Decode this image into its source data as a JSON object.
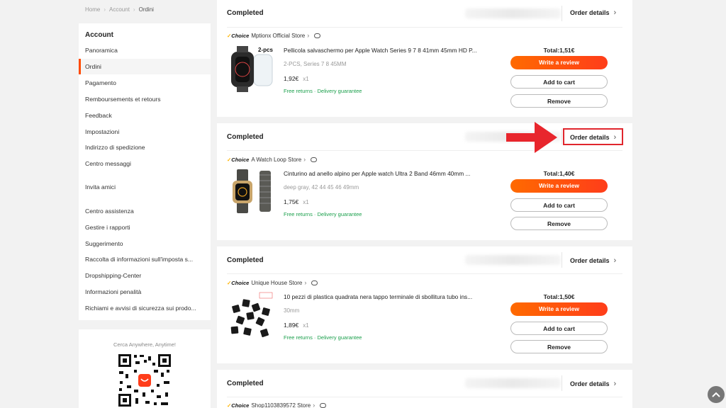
{
  "breadcrumb": [
    "Home",
    "Account",
    "Ordini"
  ],
  "sidebar": {
    "title": "Account",
    "items": [
      "Panoramica",
      "Ordini",
      "Pagamento",
      "Remboursements et retours",
      "Feedback",
      "Impostazioni",
      "Indirizzo di spedizione",
      "Centro messaggi",
      "Invita amici",
      "Centro assistenza",
      "Gestire i rapporti",
      "Suggerimento",
      "Raccolta di informazioni sull'imposta s...",
      "Dropshipping-Center",
      "Informazioni penalità",
      "Richiami e avvisi di sicurezza sui prodo..."
    ],
    "active_item": "Ordini"
  },
  "app_promo": {
    "caption": "Cerca Anywhere, Anytime!"
  },
  "orders": [
    {
      "status": "Completed",
      "order_details_label": "Order details",
      "choice_label": "Choice",
      "store": "Mptionx Official Store",
      "product": "Pellicola salvaschermo per Apple Watch Series 9 7 8 41mm 45mm HD P...",
      "variant": "2-PCS, Series 7 8 45MM",
      "price": "1,92€",
      "qty": "x1",
      "guarantee": "Free returns · Delivery guarantee",
      "total": "Total:1,51€",
      "thumb_badge": "2-pcs",
      "buttons": {
        "review": "Write a review",
        "cart": "Add to cart",
        "remove": "Remove"
      }
    },
    {
      "status": "Completed",
      "order_details_label": "Order details",
      "choice_label": "Choice",
      "store": "A Watch Loop Store",
      "product": "Cinturino ad anello alpino per Apple watch Ultra 2 Band 46mm 40mm ...",
      "variant": "deep gray, 42 44 45 46 49mm",
      "price": "1,75€",
      "qty": "x1",
      "guarantee": "Free returns · Delivery guarantee",
      "total": "Total:1,40€",
      "buttons": {
        "review": "Write a review",
        "cart": "Add to cart",
        "remove": "Remove"
      }
    },
    {
      "status": "Completed",
      "order_details_label": "Order details",
      "choice_label": "Choice",
      "store": "Unique House Store",
      "product": "10 pezzi di plastica quadrata nera tappo terminale di sbollitura tubo ins...",
      "variant": "30mm",
      "price": "1,89€",
      "qty": "x1",
      "guarantee": "Free returns · Delivery guarantee",
      "total": "Total:1,50€",
      "buttons": {
        "review": "Write a review",
        "cart": "Add to cart",
        "remove": "Remove"
      }
    },
    {
      "status": "Completed",
      "order_details_label": "Order details",
      "choice_label": "Choice",
      "store": "Shop1103839572 Store"
    }
  ],
  "colors": {
    "accent": "#ff4b00",
    "review_button": "#ff5a10",
    "highlight": "#e0262d",
    "guarantee": "#1a9f4b"
  }
}
